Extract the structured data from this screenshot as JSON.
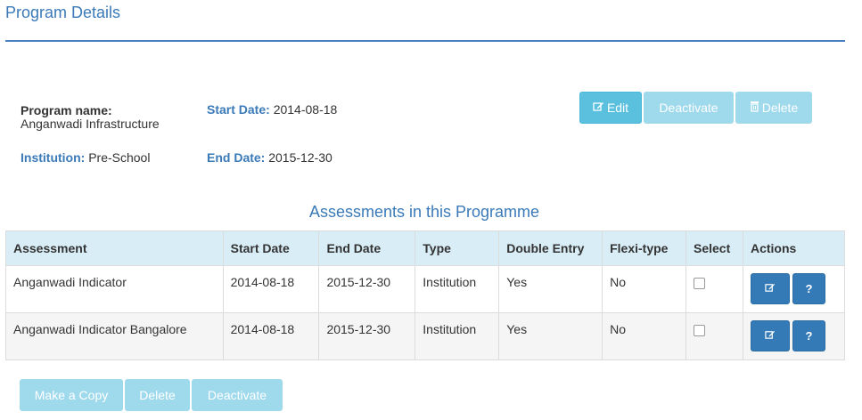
{
  "page": {
    "title": "Program Details"
  },
  "program": {
    "name_label": "Program name:",
    "name_value": "Anganwadi Infrastructure",
    "start_label": "Start Date:",
    "start_value": "2014-08-18",
    "institution_label": "Institution:",
    "institution_value": "Pre-School",
    "end_label": "End Date:",
    "end_value": "2015-12-30"
  },
  "top_actions": {
    "edit": {
      "label": "Edit",
      "icon": "edit-icon",
      "enabled": true
    },
    "deactivate": {
      "label": "Deactivate",
      "enabled": false
    },
    "delete": {
      "label": "Delete",
      "icon": "trash-icon",
      "enabled": false
    }
  },
  "assessments": {
    "title": "Assessments in this Programme",
    "columns": [
      "Assessment",
      "Start Date",
      "End Date",
      "Type",
      "Double Entry",
      "Flexi-type",
      "Select",
      "Actions"
    ],
    "rows": [
      {
        "assessment": "Anganwadi Indicator",
        "start_date": "2014-08-18",
        "end_date": "2015-12-30",
        "type": "Institution",
        "double_entry": "Yes",
        "flexi_type": "No",
        "selected": false,
        "help_label": "?"
      },
      {
        "assessment": "Anganwadi Indicator Bangalore",
        "start_date": "2014-08-18",
        "end_date": "2015-12-30",
        "type": "Institution",
        "double_entry": "Yes",
        "flexi_type": "No",
        "selected": false,
        "help_label": "?"
      }
    ]
  },
  "bottom_actions": {
    "copy": "Make a Copy",
    "delete": "Delete",
    "deactivate": "Deactivate"
  },
  "colors": {
    "heading": "#3a7ab8",
    "info_button": "#5bc0de",
    "disabled_button": "#9ed9ec",
    "primary_button": "#337ab7",
    "table_header": "#d9edf7"
  }
}
